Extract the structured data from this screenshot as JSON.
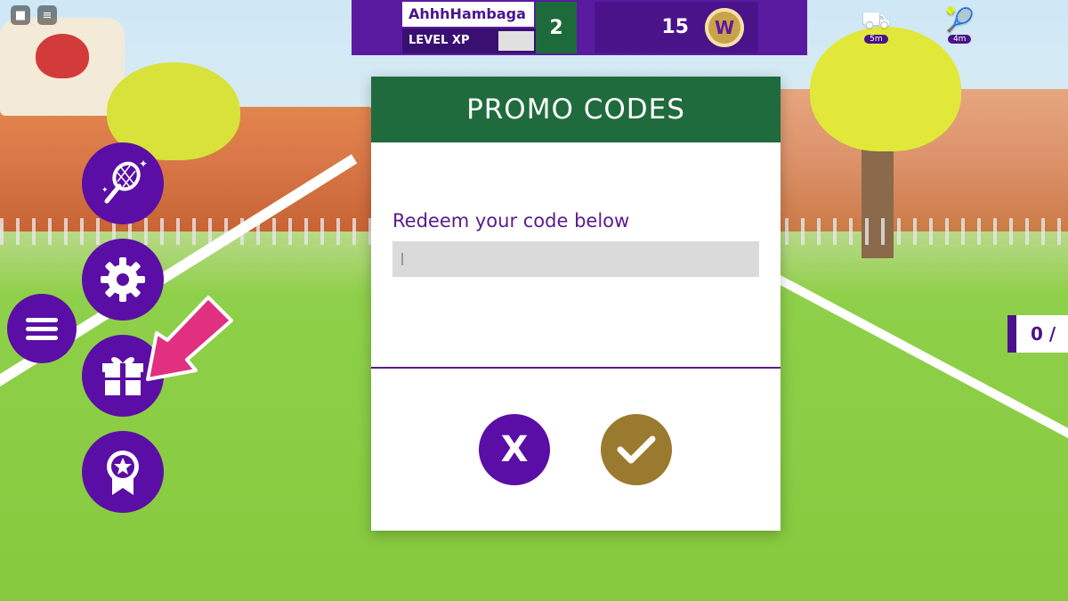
{
  "player": {
    "name": "AhhhHambaga",
    "xp_label": "LEVEL XP",
    "level": "2",
    "xp_progress": 0.27,
    "coins": "15",
    "coin_icon": "W"
  },
  "hud_right": [
    {
      "icon": "lawn-mower-icon",
      "distance": "5m"
    },
    {
      "icon": "tennis-racket-icon",
      "distance": "4m"
    }
  ],
  "counter_text": "0 /",
  "side_menu": [
    {
      "name": "tennis-racket-button",
      "icon": "tennis-racket-icon"
    },
    {
      "name": "settings-button",
      "icon": "gear-icon"
    },
    {
      "name": "menu-button",
      "icon": "hamburger-icon"
    },
    {
      "name": "promo-codes-button",
      "icon": "gift-icon"
    },
    {
      "name": "badges-button",
      "icon": "badge-icon"
    }
  ],
  "dialog": {
    "title": "PROMO CODES",
    "prompt": "Redeem your code below",
    "input_value": "",
    "cancel_label": "X",
    "confirm_icon": "check-icon"
  },
  "colors": {
    "purple": "#5a0ea5",
    "dark_purple": "#4a138a",
    "green": "#1f6b3d",
    "gold": "#9a7a2e",
    "arrow_pink": "#e0307f"
  }
}
